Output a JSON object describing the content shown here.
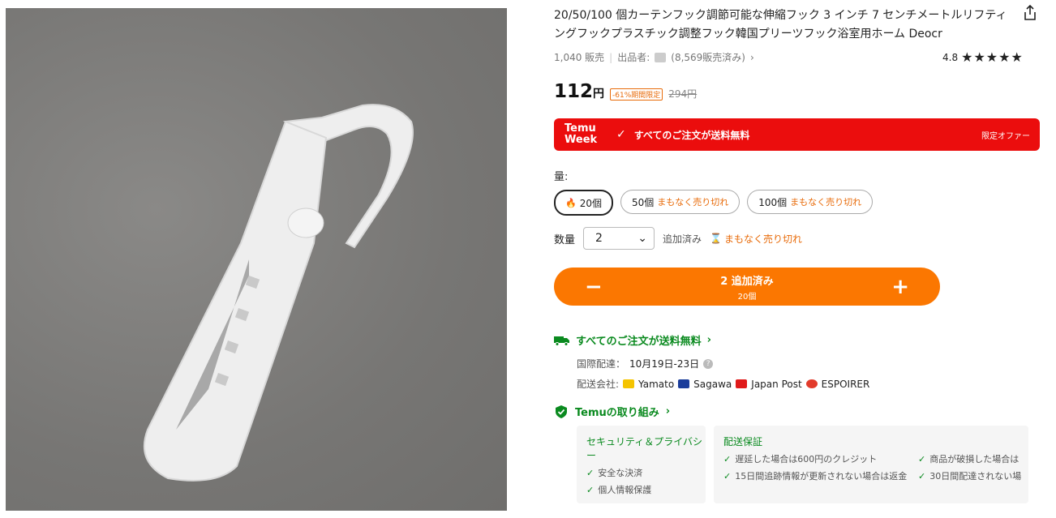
{
  "product": {
    "title": "20/50/100 個カーテンフック調節可能な伸縮フック 3 インチ 7 センチメートルリフティングフックプラスチック調整フック韓国プリーツフック浴室用ホーム Deocr",
    "sold": "1,040 販売",
    "seller_label": "出品者:",
    "seller_sales": "(8,569販売済み)",
    "rating": "4.8",
    "stars": "★★★★★"
  },
  "price": {
    "current": "112",
    "currency": "円",
    "discount": "-61%期間限定",
    "original": "294円"
  },
  "banner": {
    "brand_line1": "Temu",
    "brand_line2": "Week",
    "text": "すべてのご注文が送料無料",
    "right": "限定オファー",
    "color": "#eb0d0d"
  },
  "quantity_options": {
    "label": "量:",
    "options": [
      {
        "label": "20個",
        "note": ""
      },
      {
        "label": "50個",
        "note": "まもなく売り切れ"
      },
      {
        "label": "100個",
        "note": "まもなく売り切れ"
      }
    ]
  },
  "quantity": {
    "label": "数量",
    "value": "2",
    "added": "追加済み",
    "soon": "まもなく売り切れ"
  },
  "cart_button": {
    "minus": "−",
    "plus": "+",
    "line1": "2 追加済み",
    "line2": "20個",
    "color": "#fb7701"
  },
  "shipping": {
    "heading": "すべてのご注文が送料無料",
    "intl_label": "国際配達：",
    "intl_value": "10月19日-23日",
    "company_label": "配送会社:",
    "carriers": [
      "Yamato",
      "Sagawa",
      "Japan Post",
      "ESPOIRER"
    ]
  },
  "commitment": {
    "heading": "Temuの取り組み",
    "security": {
      "title": "セキュリティ＆プライバシー",
      "items": [
        "安全な決済",
        "個人情報保護"
      ]
    },
    "delivery": {
      "title": "配送保証",
      "items": [
        "遅延した場合は600円のクレジット",
        "15日間追跡情報が更新されない場合は返金"
      ],
      "items_right": [
        "商品が破損した場合は",
        "30日間配達されない場"
      ]
    }
  },
  "colors": {
    "accent": "#fb7701",
    "green": "#0a8a1f",
    "red": "#eb0d0d"
  }
}
